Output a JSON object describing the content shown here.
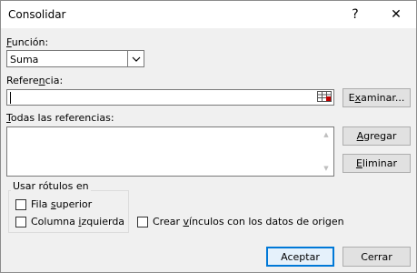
{
  "window": {
    "title": "Consolidar",
    "help_glyph": "?",
    "close_glyph": "✕"
  },
  "funcion": {
    "label_pre": "",
    "label_ul": "F",
    "label_post": "unción:",
    "value": "Suma"
  },
  "referencia": {
    "label_pre": "Refere",
    "label_ul": "n",
    "label_post": "cia:",
    "value": ""
  },
  "examinar": {
    "pre": "E",
    "ul": "x",
    "post": "aminar..."
  },
  "todas": {
    "label_pre": "",
    "label_ul": "T",
    "label_post": "odas las referencias:"
  },
  "agregar": {
    "pre": "",
    "ul": "A",
    "post": "gregar"
  },
  "eliminar": {
    "pre": "",
    "ul": "E",
    "post": "liminar"
  },
  "rotulos": {
    "label": "Usar rótulos en",
    "fila": {
      "pre": "Fila ",
      "ul": "s",
      "post": "uperior",
      "checked": false
    },
    "columna": {
      "pre": "Columna ",
      "ul": "i",
      "post": "zquierda",
      "checked": false
    }
  },
  "vinculos": {
    "pre": "Crear ",
    "ul": "v",
    "post": "ínculos con los datos de origen",
    "checked": false
  },
  "aceptar": "Aceptar",
  "cerrar": "Cerrar",
  "colors": {
    "accent": "#0078d7",
    "dialog_bg": "#f0f0f0"
  }
}
